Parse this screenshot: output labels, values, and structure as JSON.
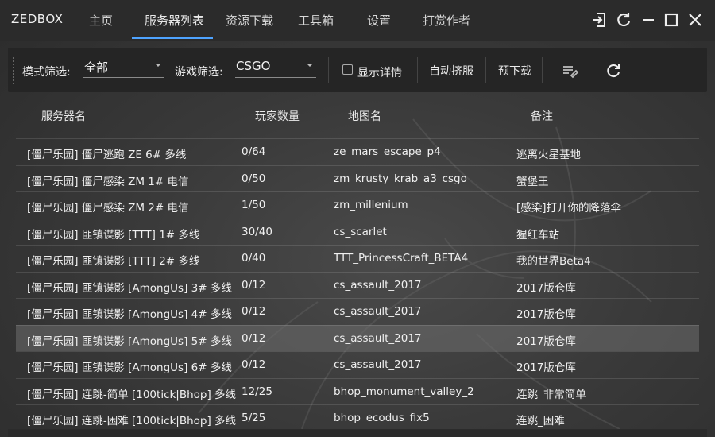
{
  "app": {
    "brand": "ZEDBOX"
  },
  "nav": {
    "tabs": [
      {
        "label": "主页"
      },
      {
        "label": "服务器列表"
      },
      {
        "label": "资源下载"
      },
      {
        "label": "工具箱"
      },
      {
        "label": "设置"
      },
      {
        "label": "打赏作者"
      }
    ],
    "active_tab": "服务器列表"
  },
  "window_controls": [
    "login-icon",
    "refresh-icon",
    "minimize-icon",
    "maximize-icon",
    "close-icon"
  ],
  "toolbar": {
    "mode_filter_label": "模式筛选:",
    "mode_filter_value": "全部",
    "game_filter_label": "游戏筛选:",
    "game_filter_value": "CSGO",
    "show_details_label": "显示详情",
    "show_details_checked": false,
    "auto_squeeze_label": "自动挤服",
    "predownload_label": "预下载",
    "icons": [
      "edit-list-icon",
      "refresh-icon"
    ]
  },
  "table": {
    "columns": [
      "服务器名",
      "玩家数量",
      "地图名",
      "备注"
    ],
    "selected_index": 7,
    "rows": [
      {
        "name": "[僵尸乐园] 僵尸逃跑 ZE 6# 多线",
        "players": "0/64",
        "map": "ze_mars_escape_p4",
        "note": "逃离火星基地"
      },
      {
        "name": "[僵尸乐园] 僵尸感染 ZM 1# 电信",
        "players": "0/50",
        "map": "zm_krusty_krab_a3_csgo",
        "note": "蟹堡王"
      },
      {
        "name": "[僵尸乐园] 僵尸感染 ZM 2# 电信",
        "players": "1/50",
        "map": "zm_millenium",
        "note": "[感染]打开你的降落伞"
      },
      {
        "name": "[僵尸乐园] 匪镇谍影 [TTT] 1# 多线",
        "players": "30/40",
        "map": "cs_scarlet",
        "note": "猩红车站"
      },
      {
        "name": "[僵尸乐园] 匪镇谍影 [TTT] 2# 多线",
        "players": "0/40",
        "map": "TTT_PrincessCraft_BETA4",
        "note": "我的世界Beta4"
      },
      {
        "name": "[僵尸乐园] 匪镇谍影 [AmongUs] 3# 多线",
        "players": "0/12",
        "map": "cs_assault_2017",
        "note": "2017版仓库"
      },
      {
        "name": "[僵尸乐园] 匪镇谍影 [AmongUs] 4# 多线",
        "players": "0/12",
        "map": "cs_assault_2017",
        "note": "2017版仓库"
      },
      {
        "name": "[僵尸乐园] 匪镇谍影 [AmongUs] 5# 多线",
        "players": "0/12",
        "map": "cs_assault_2017",
        "note": "2017版仓库"
      },
      {
        "name": "[僵尸乐园] 匪镇谍影 [AmongUs] 6# 多线",
        "players": "0/12",
        "map": "cs_assault_2017",
        "note": "2017版仓库"
      },
      {
        "name": "[僵尸乐园] 连跳-简单 [100tick|Bhop] 多线",
        "players": "12/25",
        "map": "bhop_monument_valley_2",
        "note": "连跳_非常简单"
      },
      {
        "name": "[僵尸乐园] 连跳-困难 [100tick|Bhop] 多线",
        "players": "5/25",
        "map": "bhop_ecodus_fix5",
        "note": "连跳_困难"
      }
    ]
  },
  "colors": {
    "accent": "#4ea3ff",
    "background": "#2f2f2f",
    "toolbar": "#252525",
    "selected_row": "#5a5a5a"
  }
}
